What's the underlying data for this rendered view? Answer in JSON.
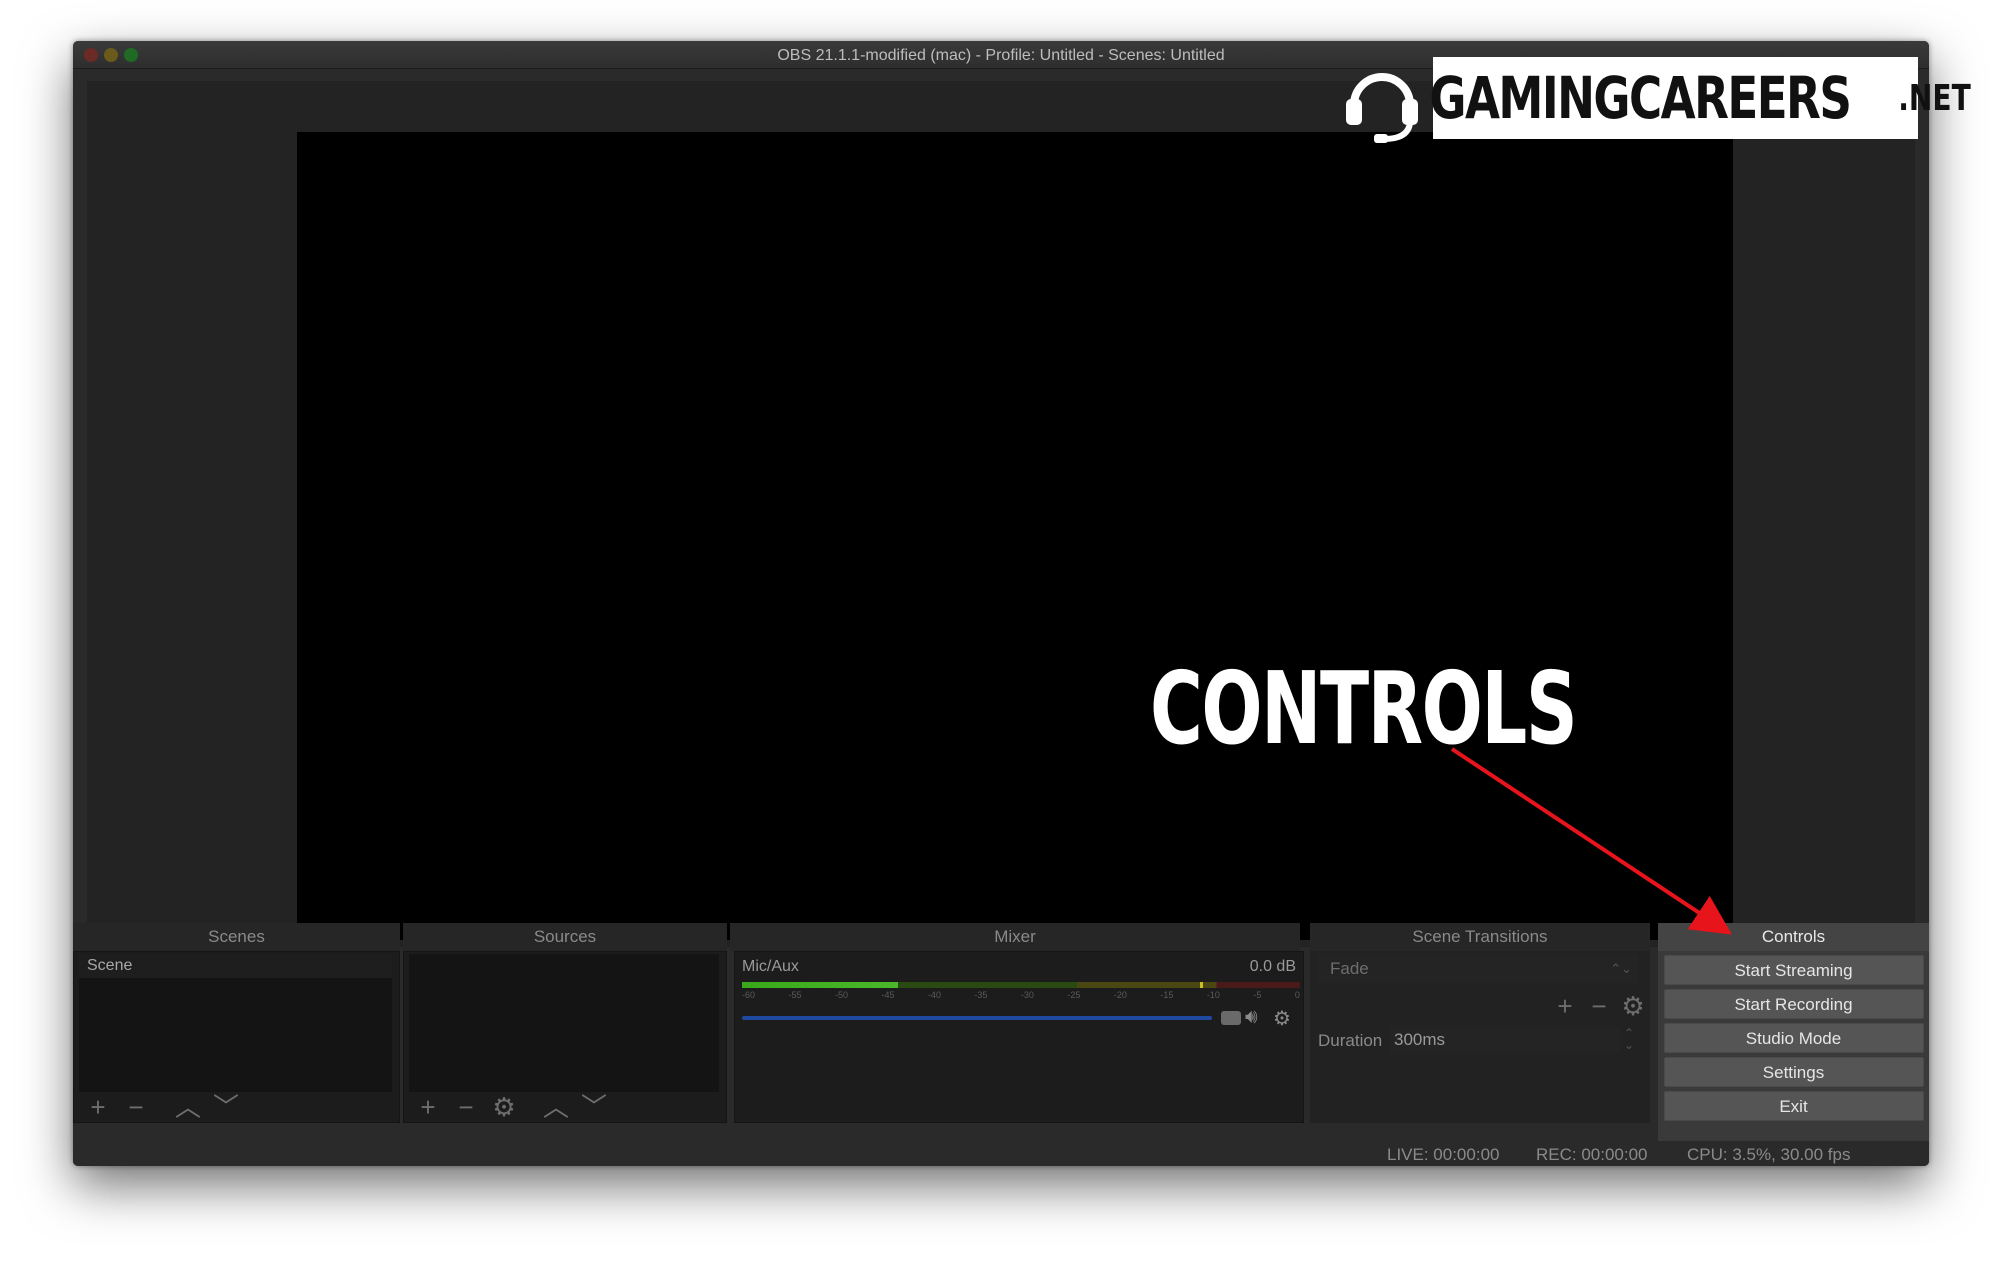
{
  "window": {
    "title": "OBS 21.1.1-modified (mac) - Profile: Untitled - Scenes: Untitled"
  },
  "docks": {
    "scenes": {
      "header": "Scenes",
      "items": [
        "Scene"
      ]
    },
    "sources": {
      "header": "Sources"
    },
    "mixer": {
      "header": "Mixer",
      "channel": "Mic/Aux",
      "level": "0.0 dB",
      "ticks": [
        "-60",
        "-55",
        "-50",
        "-45",
        "-40",
        "-35",
        "-30",
        "-25",
        "-20",
        "-15",
        "-10",
        "-5",
        "0"
      ]
    },
    "transitions": {
      "header": "Scene Transitions",
      "selected": "Fade",
      "duration_label": "Duration",
      "duration_value": "300ms"
    },
    "controls": {
      "header": "Controls",
      "start_streaming": "Start Streaming",
      "start_recording": "Start Recording",
      "studio_mode": "Studio Mode",
      "settings": "Settings",
      "exit": "Exit"
    }
  },
  "status": {
    "live": "LIVE: 00:00:00",
    "rec": "REC: 00:00:00",
    "cpu": "CPU: 3.5%, 30.00 fps"
  },
  "overlay": {
    "logo_main": "GAMINGCAREERS",
    "logo_suffix": ".NET",
    "annotation": "CONTROLS"
  },
  "icons": {
    "add": "plus-icon",
    "remove": "minus-icon",
    "up": "chevron-up-icon",
    "down": "chevron-down-icon",
    "gear": "gear-icon",
    "speaker": "speaker-icon"
  },
  "colors": {
    "arrow": "#e8141b",
    "volume": "#1f4aa0",
    "meter_green": "#3aa81b"
  }
}
